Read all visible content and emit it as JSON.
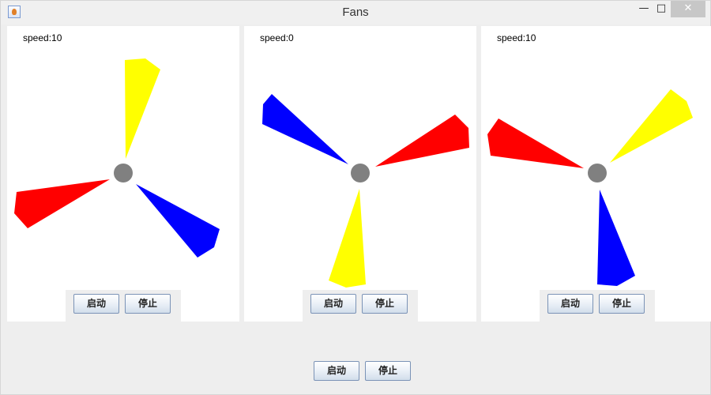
{
  "window": {
    "title": "Fans"
  },
  "colors": {
    "blade1": "#ffff00",
    "blade2": "#0000ff",
    "blade3": "#ff0000",
    "hub": "#808080"
  },
  "panels": [
    {
      "speed_label": "speed:10",
      "start_label": "启动",
      "stop_label": "停止"
    },
    {
      "speed_label": "speed:0",
      "start_label": "启动",
      "stop_label": "停止"
    },
    {
      "speed_label": "speed:10",
      "start_label": "启动",
      "stop_label": "停止"
    }
  ],
  "global_controls": {
    "start_label": "启动",
    "stop_label": "停止"
  }
}
